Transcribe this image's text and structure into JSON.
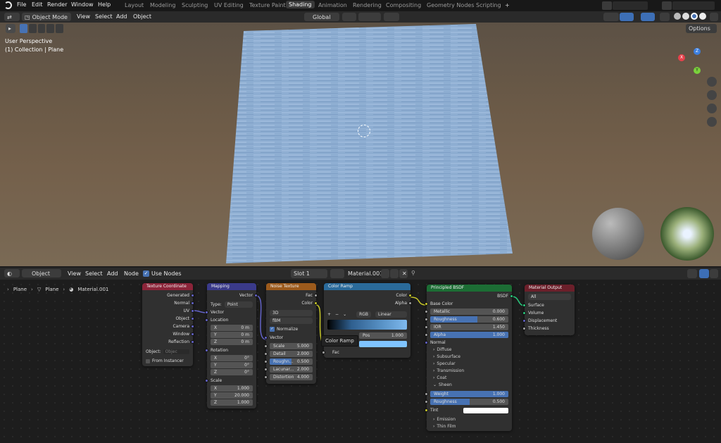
{
  "topbar": {
    "menus": [
      "File",
      "Edit",
      "Render",
      "Window",
      "Help"
    ],
    "workspaces": [
      "Layout",
      "Modeling",
      "Sculpting",
      "UV Editing",
      "Texture Paint",
      "Shading",
      "Animation",
      "Rendering",
      "Compositing",
      "Geometry Nodes",
      "Scripting"
    ],
    "active_workspace": "Shading",
    "add": "+"
  },
  "viewport_header": {
    "mode": "Object Mode",
    "menus": [
      "View",
      "Select",
      "Add",
      "Object"
    ],
    "orientation": "Global",
    "options": "Options"
  },
  "viewport": {
    "perspective": "User Perspective",
    "collection": "(1) Collection | Plane",
    "gizmo": {
      "x": "X",
      "y": "Y",
      "z": "Z"
    }
  },
  "node_header": {
    "type": "Object",
    "menus": [
      "View",
      "Select",
      "Add",
      "Node"
    ],
    "use_nodes": "Use Nodes",
    "slot": "Slot 1",
    "material": "Material.001"
  },
  "breadcrumb": [
    "Plane",
    "Plane",
    "Material.001"
  ],
  "nodes": {
    "texcoord": {
      "title": "Texture Coordinate",
      "outputs": [
        "Generated",
        "Normal",
        "UV",
        "Object",
        "Camera",
        "Window",
        "Reflection"
      ],
      "object_label": "Object:",
      "object_placeholder": "Objec",
      "from_instancer": "From Instancer"
    },
    "mapping": {
      "title": "Mapping",
      "vector_out": "Vector",
      "type_label": "Type:",
      "type": "Point",
      "vector_in": "Vector",
      "location": "Location",
      "loc": [
        {
          "a": "X",
          "v": "0 m"
        },
        {
          "a": "Y",
          "v": "0 m"
        },
        {
          "a": "Z",
          "v": "0 m"
        }
      ],
      "rotation": "Rotation",
      "rot": [
        {
          "a": "X",
          "v": "0°"
        },
        {
          "a": "Y",
          "v": "0°"
        },
        {
          "a": "Z",
          "v": "0°"
        }
      ],
      "scale": "Scale",
      "scl": [
        {
          "a": "X",
          "v": "1.000"
        },
        {
          "a": "Y",
          "v": "20.000"
        },
        {
          "a": "Z",
          "v": "1.000"
        }
      ]
    },
    "noise": {
      "title": "Noise Texture",
      "fac": "Fac",
      "color": "Color",
      "dim": "3D",
      "basis": "fBM",
      "normalize": "Normalize",
      "vector": "Vector",
      "params": [
        {
          "n": "Scale",
          "v": "5.000"
        },
        {
          "n": "Detail",
          "v": "2.000"
        },
        {
          "n": "Roughn...",
          "v": "0.500",
          "f": 0.5
        },
        {
          "n": "Lacunar...",
          "v": "2.000"
        },
        {
          "n": "Distortion",
          "v": "4.000"
        }
      ]
    },
    "ramp": {
      "title": "Color Ramp",
      "color": "Color",
      "alpha": "Alpha",
      "mode": "RGB",
      "interp": "Linear",
      "pos_label": "Pos",
      "pos": "1.000",
      "fac": "Fac",
      "tooltip": "Color Ramp"
    },
    "bsdf": {
      "title": "Principled BSDF",
      "bsdf": "BSDF",
      "base_color": "Base Color",
      "params": [
        {
          "n": "Metallic",
          "v": "0.000",
          "f": 0
        },
        {
          "n": "Roughness",
          "v": "0.600",
          "f": 0.6
        },
        {
          "n": "IOR",
          "v": "1.450",
          "f": 0
        },
        {
          "n": "Alpha",
          "v": "1.000",
          "f": 1
        }
      ],
      "normal": "Normal",
      "panels": [
        "Diffuse",
        "Subsurface",
        "Specular",
        "Transmission",
        "Coat"
      ],
      "sheen": "Sheen",
      "sheen_params": [
        {
          "n": "Weight",
          "v": "1.000",
          "f": 1
        },
        {
          "n": "Roughness",
          "v": "0.500",
          "f": 0.5
        }
      ],
      "tint": "Tint",
      "panels2": [
        "Emission",
        "Thin Film"
      ]
    },
    "output": {
      "title": "Material Output",
      "target": "All",
      "inputs": [
        "Surface",
        "Volume",
        "Displacement",
        "Thickness"
      ]
    }
  },
  "colors": {
    "accent": "#4772b3",
    "bsdf_header": "#1c6d34",
    "input_header": "#8b2439",
    "vector_header": "#3a3a8a",
    "texture_header": "#9c5a1c",
    "converter_header": "#2a6a9a",
    "output_header": "#6b1f2a"
  }
}
